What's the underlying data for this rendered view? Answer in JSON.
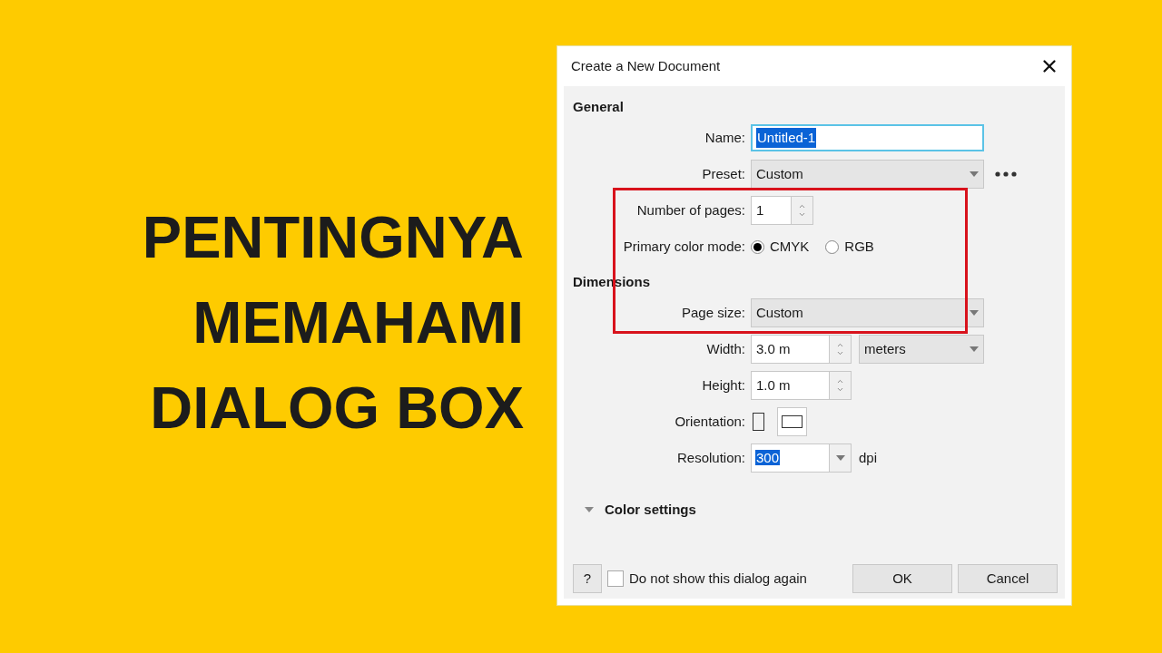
{
  "headline": [
    "PENTINGNYA",
    "MEMAHAMI",
    "DIALOG BOX"
  ],
  "dialog": {
    "title": "Create a New Document",
    "sections": [
      {
        "heading": "General",
        "fields": [
          {
            "kind": "text",
            "label": "Name:",
            "value": "Untitled-1",
            "selected": true
          },
          {
            "kind": "dropdown",
            "label": "Preset:",
            "value": "Custom",
            "more": true
          },
          {
            "kind": "spinner",
            "label": "Number of pages:",
            "value": "1",
            "narrow": true
          },
          {
            "kind": "radio",
            "label": "Primary color mode:",
            "options": [
              {
                "label": "CMYK",
                "selected": true
              },
              {
                "label": "RGB",
                "selected": false
              }
            ]
          }
        ]
      },
      {
        "heading": "Dimensions",
        "fields": [
          {
            "kind": "dropdown",
            "label": "Page size:",
            "value": "Custom"
          },
          {
            "kind": "spinner",
            "label": "Width:",
            "value": "3.0 m",
            "unit": "meters"
          },
          {
            "kind": "spinner",
            "label": "Height:",
            "value": "1.0 m"
          },
          {
            "kind": "orientation",
            "label": "Orientation:",
            "options": [
              {
                "selected": false
              },
              {
                "selected": true
              }
            ]
          },
          {
            "kind": "combo",
            "label": "Resolution:",
            "value": "300",
            "selected": true,
            "suffix": "dpi"
          }
        ]
      }
    ],
    "collapsible": {
      "label": "Color settings",
      "expanded": false
    },
    "help": "?",
    "checkbox": {
      "label": "Do not show this dialog again",
      "checked": false
    },
    "buttons": [
      "OK",
      "Cancel"
    ]
  },
  "highlight": {
    "visible": true
  }
}
